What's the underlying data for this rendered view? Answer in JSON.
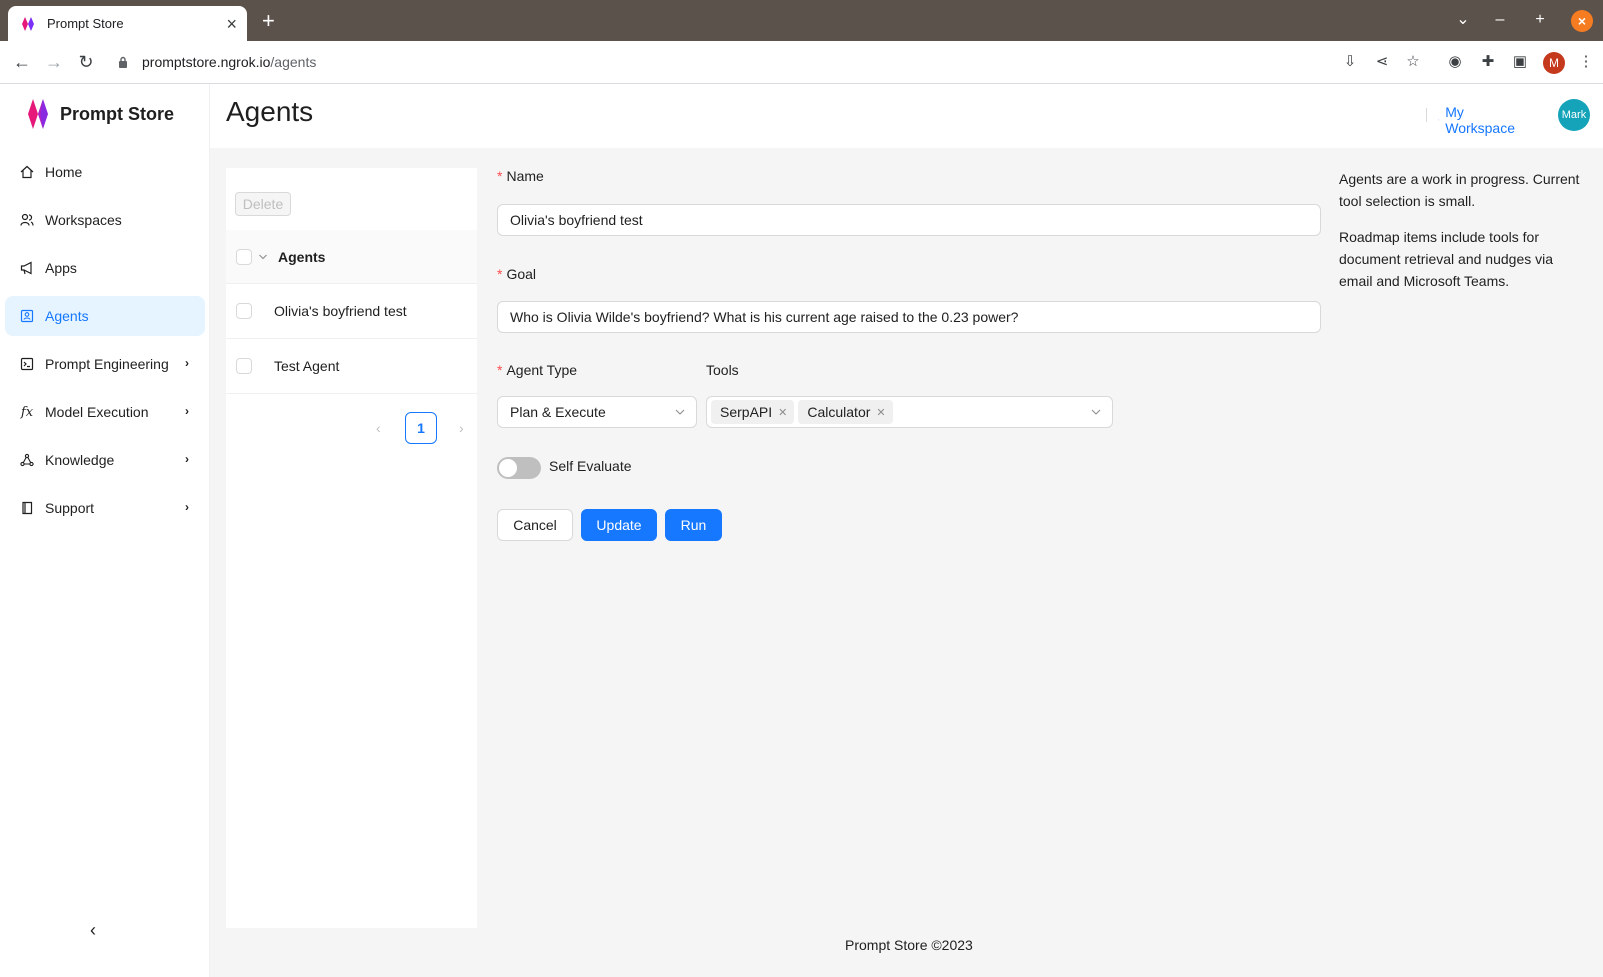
{
  "browser": {
    "tab_title": "Prompt Store",
    "url_host": "promptstore.ngrok.io",
    "url_path": "/agents",
    "profile_initial": "M"
  },
  "app": {
    "brand_name": "Prompt Store",
    "page_title": "Agents",
    "workspace_label": "My Workspace",
    "avatar_label": "Mark",
    "accent_color": "#1677ff"
  },
  "sidebar": {
    "items": [
      {
        "label": "Home",
        "icon": "home-icon"
      },
      {
        "label": "Workspaces",
        "icon": "users-icon"
      },
      {
        "label": "Apps",
        "icon": "megaphone-icon"
      },
      {
        "label": "Agents",
        "icon": "agent-icon",
        "active": true
      },
      {
        "label": "Prompt Engineering",
        "icon": "terminal-icon"
      },
      {
        "label": "Model Execution",
        "icon": "function-icon"
      },
      {
        "label": "Knowledge",
        "icon": "graph-icon"
      },
      {
        "label": "Support",
        "icon": "book-icon"
      }
    ]
  },
  "list": {
    "delete_label": "Delete",
    "header_label": "Agents",
    "rows": [
      "Olivia's boyfriend test",
      "Test Agent"
    ],
    "current_page": "1"
  },
  "form": {
    "name_label": "Name",
    "name_value": "Olivia's boyfriend test",
    "goal_label": "Goal",
    "goal_value": "Who is Olivia Wilde's boyfriend? What is his current age raised to the 0.23 power?",
    "agent_type_label": "Agent Type",
    "agent_type_value": "Plan & Execute",
    "tools_label": "Tools",
    "tools": [
      "SerpAPI",
      "Calculator"
    ],
    "self_evaluate_label": "Self Evaluate",
    "self_evaluate_on": false,
    "cancel_label": "Cancel",
    "update_label": "Update",
    "run_label": "Run"
  },
  "help": {
    "p1": "Agents are a work in progress. Current tool selection is small.",
    "p2": "Roadmap items include tools for document retrieval and nudges via email and Microsoft Teams."
  },
  "footer": "Prompt Store ©2023"
}
